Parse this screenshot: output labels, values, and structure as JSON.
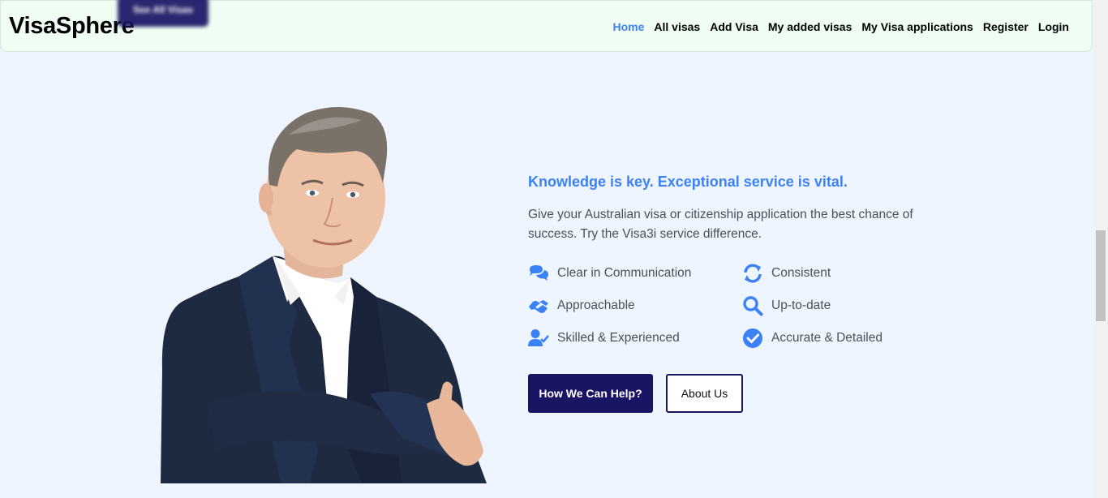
{
  "navbar": {
    "brand": "VisaSphere",
    "ghost_button_label": "See All Visas",
    "links": [
      {
        "label": "Home",
        "active": true
      },
      {
        "label": "All visas"
      },
      {
        "label": "Add Visa"
      },
      {
        "label": "My added visas"
      },
      {
        "label": "My Visa applications"
      },
      {
        "label": "Register"
      },
      {
        "label": "Login"
      }
    ]
  },
  "hero": {
    "headline": "Knowledge is key. Exceptional service is vital.",
    "description": "Give your Australian visa or citizenship application the best chance of success. Try the Visa3i service difference.",
    "features": [
      {
        "label": "Clear in Communication",
        "icon": "comments-icon"
      },
      {
        "label": "Consistent",
        "icon": "sync-icon"
      },
      {
        "label": "Approachable",
        "icon": "handshake-icon"
      },
      {
        "label": "Up-to-date",
        "icon": "search-icon"
      },
      {
        "label": "Skilled & Experienced",
        "icon": "user-check-icon"
      },
      {
        "label": "Accurate & Detailed",
        "icon": "check-circle-icon"
      }
    ],
    "primary_button": "How We Can Help?",
    "secondary_button": "About Us"
  },
  "colors": {
    "accent": "#3b82f6",
    "navy": "#1a1464",
    "navbar_bg": "#effdf3",
    "page_bg": "#eff5ff",
    "text": "#4b4f58"
  }
}
